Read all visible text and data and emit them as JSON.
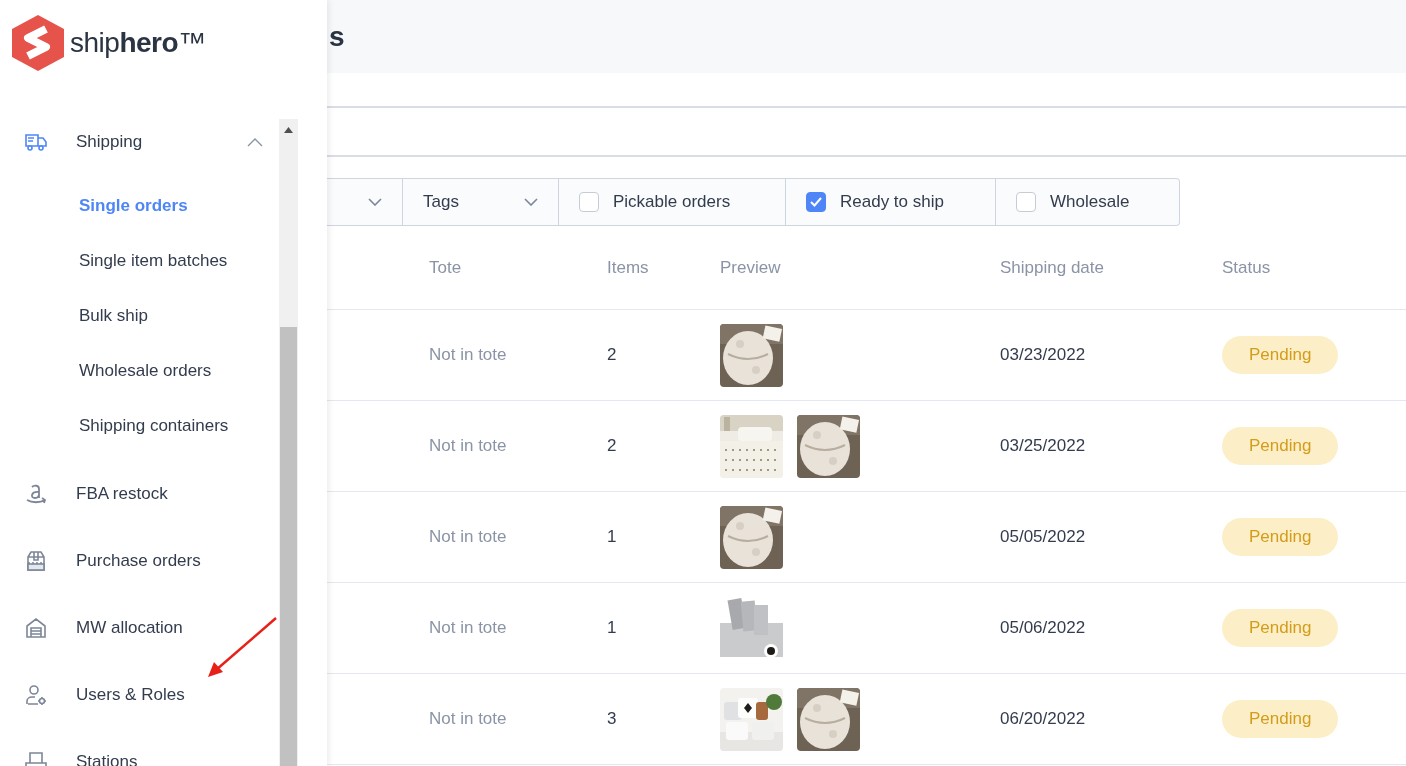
{
  "logo": {
    "text": "ship**hero**™"
  },
  "page_title": "s",
  "sidebar": {
    "items": [
      {
        "label": "Shipping",
        "expanded": true,
        "selected": false,
        "children": [
          {
            "label": "Single orders",
            "selected": true
          },
          {
            "label": "Single item batches",
            "selected": false
          },
          {
            "label": "Bulk ship",
            "selected": false
          },
          {
            "label": "Wholesale orders",
            "selected": false
          },
          {
            "label": "Shipping containers",
            "selected": false
          }
        ]
      },
      {
        "label": "FBA restock",
        "selected": false
      },
      {
        "label": "Purchase orders",
        "selected": false
      },
      {
        "label": "MW allocation",
        "selected": false
      },
      {
        "label": "Users & Roles",
        "selected": false
      },
      {
        "label": "Stations",
        "selected": false
      }
    ]
  },
  "filters": [
    {
      "kind": "dropdown"
    },
    {
      "kind": "dropdown",
      "label": "Tags"
    },
    {
      "kind": "checkbox",
      "label": "Pickable orders",
      "checked": false
    },
    {
      "kind": "checkbox",
      "label": "Ready to ship",
      "checked": true
    },
    {
      "kind": "checkbox",
      "label": "Wholesale",
      "checked": false
    }
  ],
  "table": {
    "columns": [
      "Tote",
      "Items",
      "Preview",
      "Shipping date",
      "Status"
    ],
    "rows": [
      {
        "tote": "Not in tote",
        "items": "2",
        "shipping_date": "03/23/2022",
        "status": "Pending"
      },
      {
        "tote": "Not in tote",
        "items": "2",
        "shipping_date": "03/25/2022",
        "status": "Pending"
      },
      {
        "tote": "Not in tote",
        "items": "1",
        "shipping_date": "05/05/2022",
        "status": "Pending"
      },
      {
        "tote": "Not in tote",
        "items": "1",
        "shipping_date": "05/06/2022",
        "status": "Pending"
      },
      {
        "tote": "Not in tote",
        "items": "3",
        "shipping_date": "06/20/2022",
        "status": "Pending"
      }
    ]
  }
}
